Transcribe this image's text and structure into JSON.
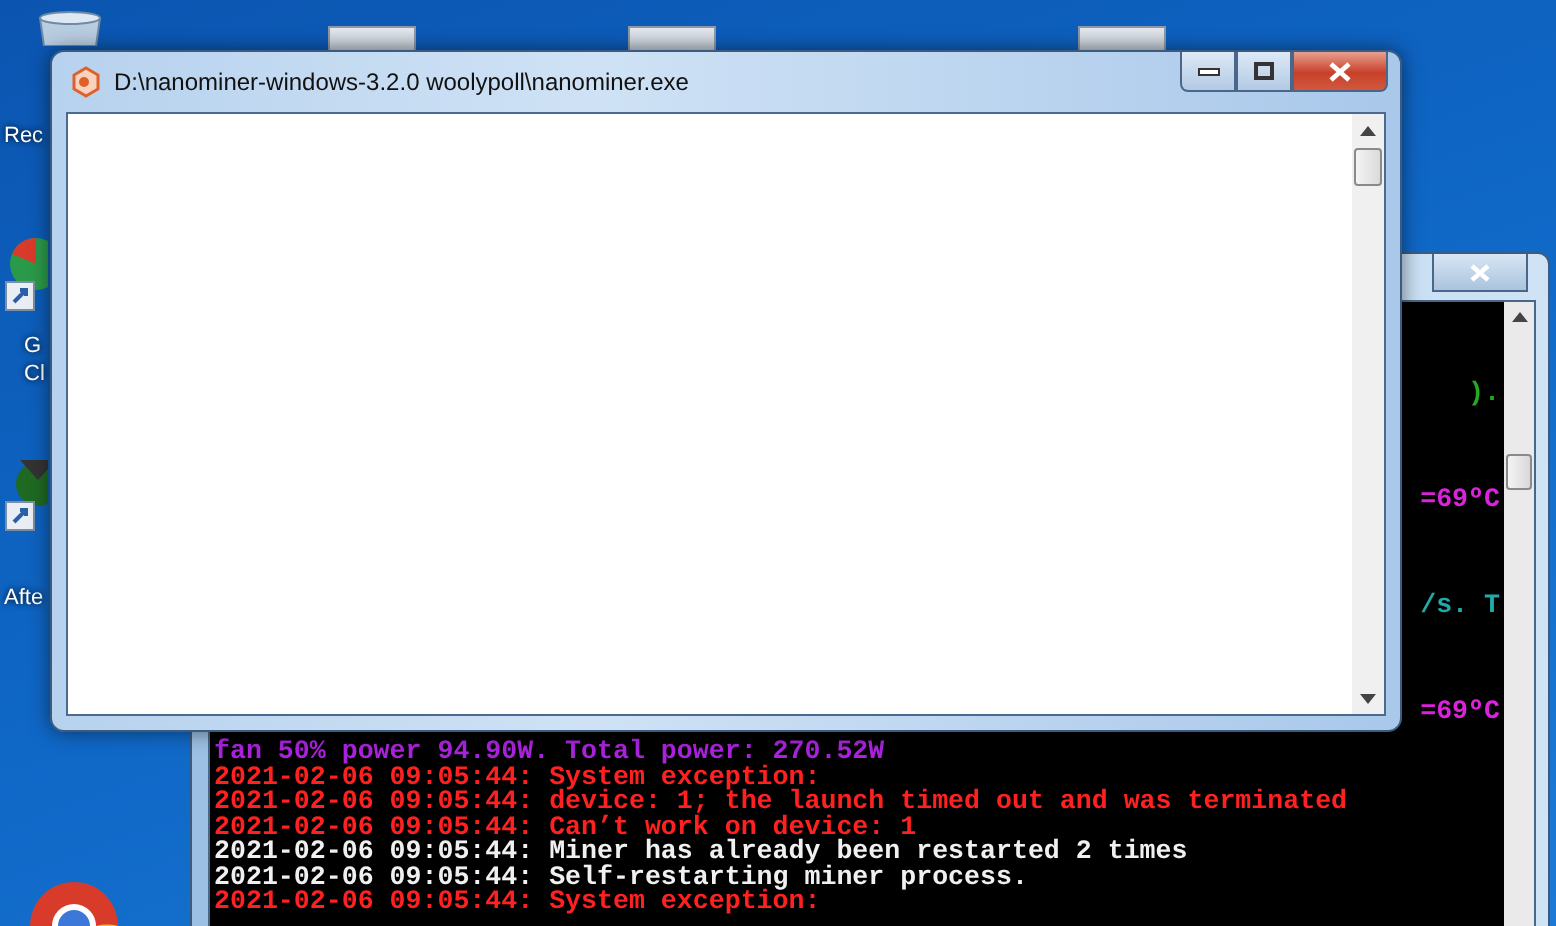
{
  "desktop_icons": [
    {
      "kind": "bin",
      "label_lines": [
        "Rec"
      ]
    },
    {
      "kind": "chrome-shortcut",
      "label_lines": [
        "G",
        "Cl"
      ]
    },
    {
      "kind": "app-shortcut",
      "label_lines": [
        "Afte"
      ]
    },
    {
      "kind": "chrome"
    }
  ],
  "front_window": {
    "title": "D:\\nanominer-windows-3.2.0 woolypoll\\nanominer.exe"
  },
  "console_window": {
    "fragments": [
      {
        "text": ").",
        "color": "#22aa22"
      },
      {
        "text": "=69ºC",
        "color": "#dd22dd"
      },
      {
        "text": "/s. T",
        "color": "#22aaaa"
      },
      {
        "text": "=69ºC",
        "color": "#dd22dd"
      }
    ],
    "lines": [
      {
        "text": "fan 50% power 94.90W. Total power: 270.52W",
        "color": "#aa22dd"
      },
      {
        "text": "2021-02-06 09:05:44: System exception:",
        "color": "#ff2020"
      },
      {
        "text": "2021-02-06 09:05:44: device: 1; the launch timed out and was terminated",
        "color": "#ff2020"
      },
      {
        "text": "2021-02-06 09:05:44: Can’t work on device: 1",
        "color": "#ff2020"
      },
      {
        "text": "2021-02-06 09:05:44: Miner has already been restarted 2 times",
        "color": "#f0f0f0"
      },
      {
        "text": "2021-02-06 09:05:44: Self-restarting miner process.",
        "color": "#f0f0f0"
      },
      {
        "text": "2021-02-06 09:05:44: System exception:",
        "color": "#ff2020"
      }
    ]
  }
}
